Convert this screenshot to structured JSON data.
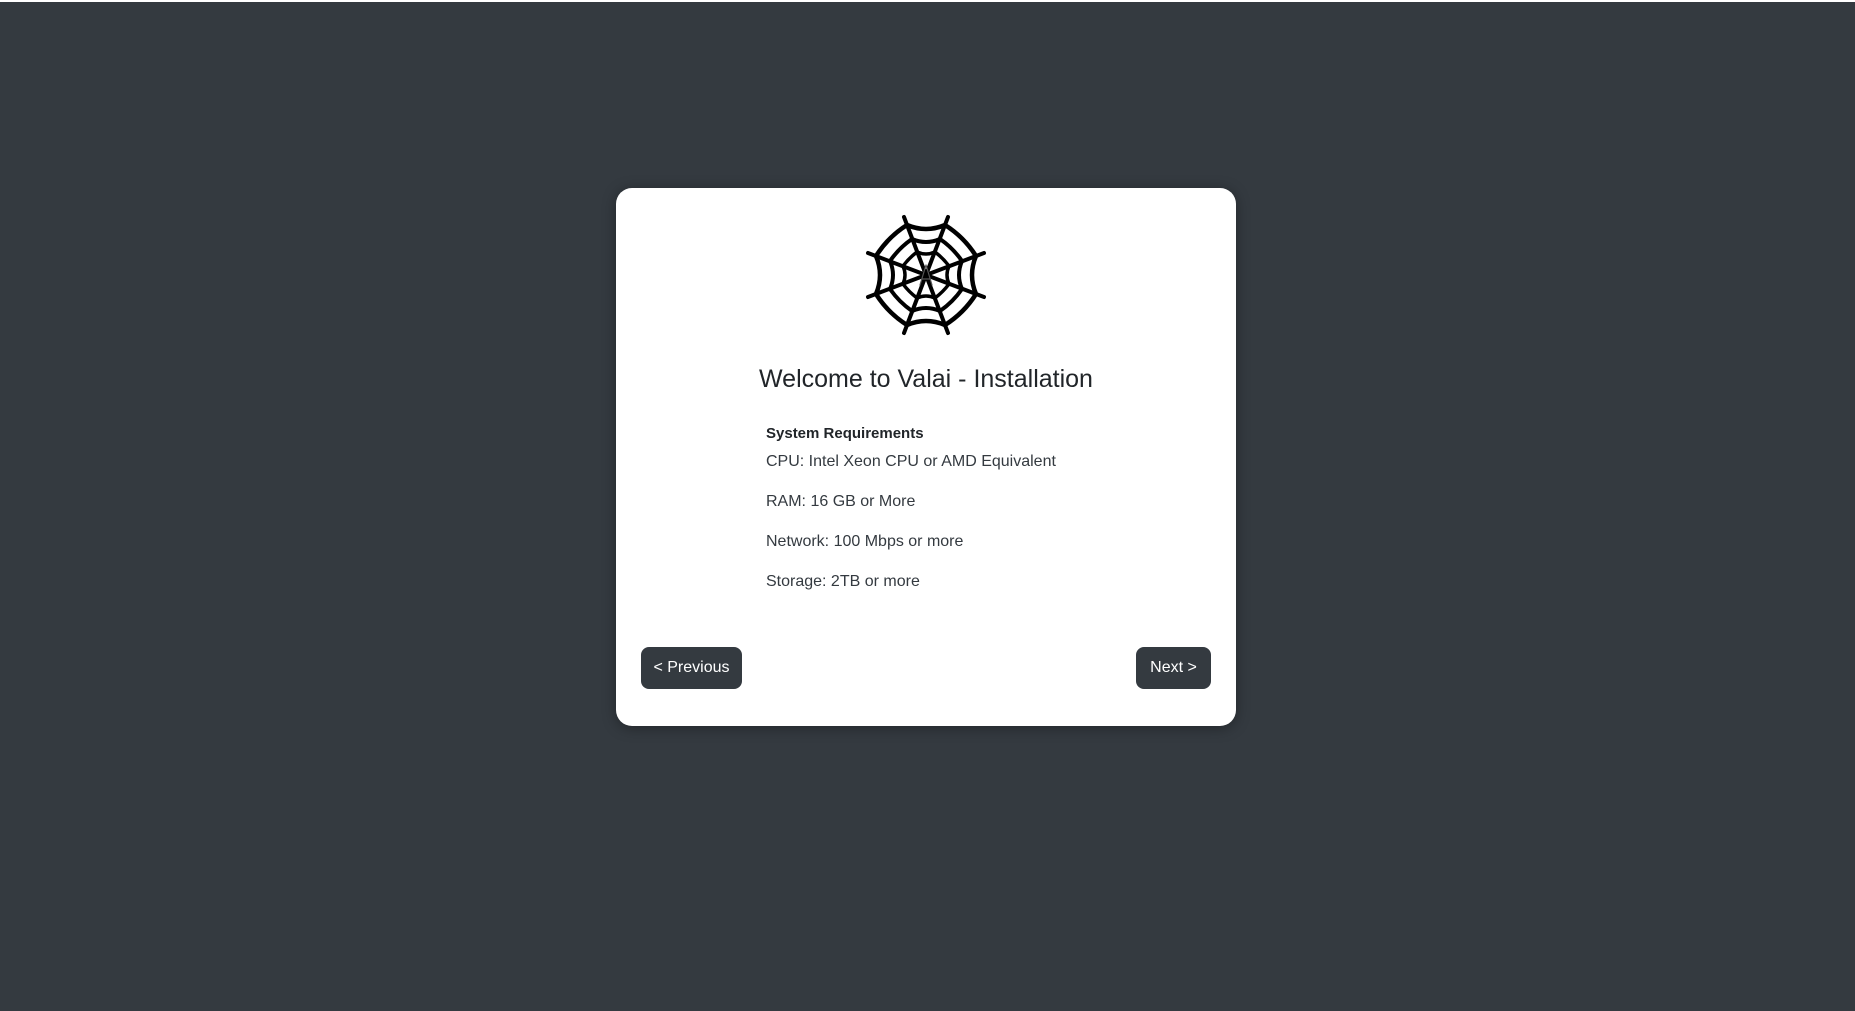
{
  "page": {
    "background_color": "#343a40",
    "card_color": "#ffffff"
  },
  "installer": {
    "logo_icon": "spider-web-icon",
    "title": "Welcome to Valai - Installation",
    "requirements": {
      "heading": "System Requirements",
      "items": [
        "CPU: Intel Xeon CPU or AMD Equivalent",
        "RAM: 16 GB or More",
        "Network: 100 Mbps or more",
        "Storage: 2TB or more"
      ]
    },
    "nav": {
      "previous_label": "< Previous",
      "next_label": "Next >",
      "button_color": "#343a40"
    }
  }
}
